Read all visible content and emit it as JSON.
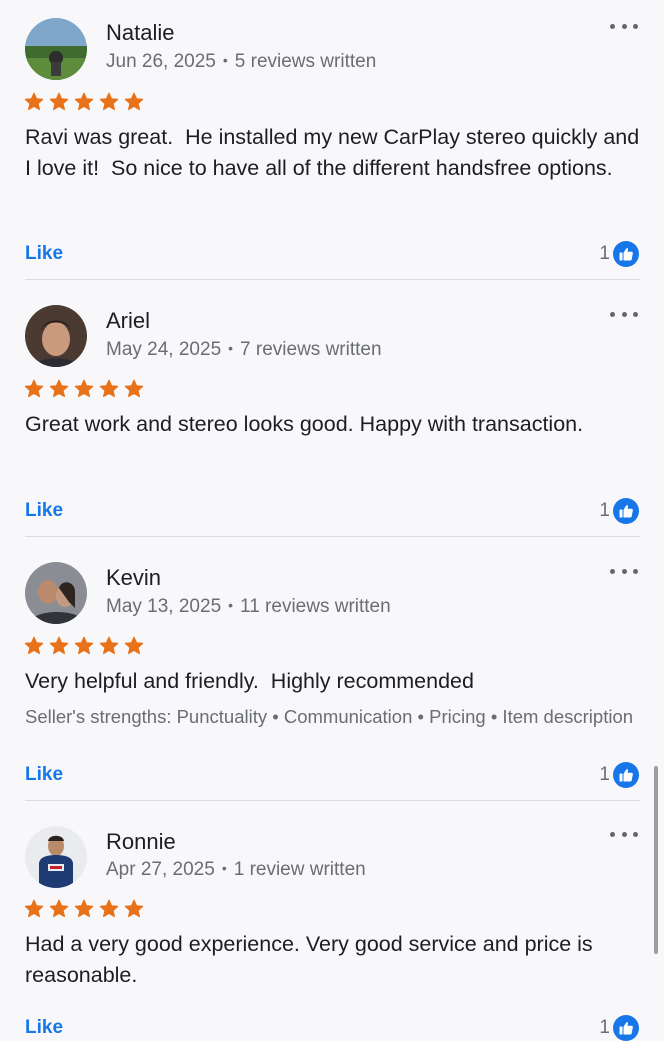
{
  "colors": {
    "star": "#e8721a",
    "link": "#1877e8",
    "meta": "#6a6d72",
    "text": "#1c1e21",
    "background": "#f8f8fa"
  },
  "icons": {
    "star": "star-icon",
    "more": "more-options-icon",
    "thumbs_up": "thumbs-up-icon"
  },
  "separator": "•",
  "reviews": [
    {
      "name": "Natalie",
      "date": "Jun 26, 2025",
      "reviews_written": "5 reviews written",
      "rating": 5,
      "text": "Ravi was great.  He installed my new CarPlay stereo quickly and I love it!  So nice to have all of the different handsfree options.",
      "like_label": "Like",
      "like_count": "1"
    },
    {
      "name": "Ariel",
      "date": "May 24, 2025",
      "reviews_written": "7 reviews written",
      "rating": 5,
      "text": "Great work and stereo looks good. Happy with transaction.",
      "like_label": "Like",
      "like_count": "1"
    },
    {
      "name": "Kevin",
      "date": "May 13, 2025",
      "reviews_written": "11 reviews written",
      "rating": 5,
      "text": "Very helpful and friendly.  Highly recommended",
      "strengths": "Seller's strengths: Punctuality • Communication • Pricing • Item description",
      "like_label": "Like",
      "like_count": "1"
    },
    {
      "name": "Ronnie",
      "date": "Apr 27, 2025",
      "reviews_written": "1 review written",
      "rating": 5,
      "text": "Had a very good experience. Very good service and price is reasonable.",
      "like_label": "Like",
      "like_count": "1"
    }
  ]
}
